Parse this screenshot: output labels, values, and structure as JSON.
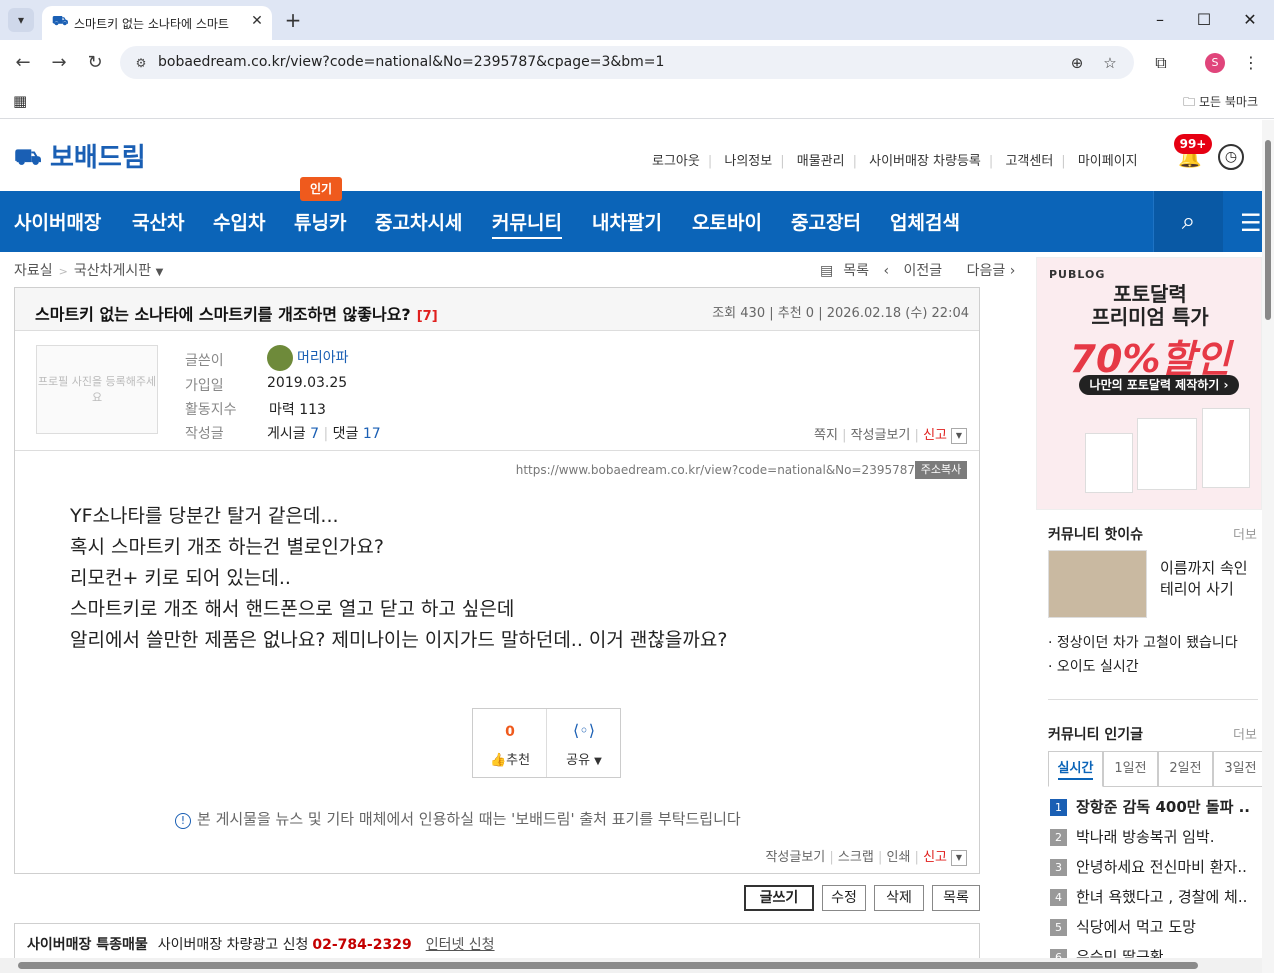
{
  "browser": {
    "tab_title": "스마트키 없는 소나타에 스마트",
    "url": "bobaedream.co.kr/view?code=national&No=2395787&cpage=3&bm=1",
    "profile_initial": "S",
    "bookmarks_all": "모든 북마크"
  },
  "header": {
    "logo_text": "보배드림",
    "links": [
      "로그아웃",
      "나의정보",
      "매물관리",
      "사이버매장 차량등록",
      "고객센터",
      "마이페이지"
    ],
    "notification_count": "99+"
  },
  "gnb": {
    "items": [
      "사이버매장",
      "국산차",
      "수입차",
      "튜닝카",
      "중고차시세",
      "커뮤니티",
      "내차팔기",
      "오토바이",
      "중고장터",
      "업체검색"
    ],
    "hot_badge": "인기"
  },
  "breadcrumb": {
    "root": "자료실",
    "board": "국산차게시판"
  },
  "post_nav": {
    "list": "목록",
    "prev": "이전글",
    "next": "다음글"
  },
  "post": {
    "title": "스마트키 없는 소나타에 스마트키를 개조하면 않좋나요?",
    "comment_count": "[7]",
    "views": "조회 430",
    "recommend": "추천 0",
    "date": "2026.02.18 (수) 22:04",
    "profile_placeholder": "프로필 사진을 등록해주세요",
    "author_label": "글쓴이",
    "author_name": "머리아파",
    "joined_label": "가입일",
    "joined": "2019.03.25",
    "activity_label": "활동지수",
    "activity": "마력 113",
    "posts_label": "작성글",
    "posts_text": "게시글",
    "posts_count": "7",
    "comments_text": "댓글",
    "comments_count": "17",
    "author_tools": [
      "쪽지",
      "작성글보기"
    ],
    "report": "신고",
    "permalink": "https://www.bobaedream.co.kr/view?code=national&No=2395787",
    "copy_label": "주소복사",
    "body": [
      "YF소나타를 당분간 탈거 같은데...",
      "혹시 스마트키 개조 하는건 별로인가요?",
      "리모컨+ 키로 되어 있는데..",
      "스마트키로 개조 해서 핸드폰으로 열고 닫고 하고 싶은데",
      "알리에서 쓸만한 제품은 없나요? 제미나이는 이지가드 말하던데..  이거 괜찮을까요?"
    ],
    "rec_count": "0",
    "rec_label": "추천",
    "share_label": "공유",
    "notice": "본 게시물을 뉴스 및 기타 매체에서 인용하실 때는 '보배드림' 출처 표기를 부탁드립니다",
    "bottom_tools": [
      "작성글보기",
      "스크랩",
      "인쇄"
    ]
  },
  "actions": {
    "write": "글쓰기",
    "edit": "수정",
    "delete": "삭제",
    "list": "목록"
  },
  "ad_bar": {
    "title": "사이버매장 특종매물",
    "text": "사이버매장 차량광고 신청",
    "phone": "02-784-2329",
    "link": "인터넷 신청"
  },
  "sidebar": {
    "ad": {
      "brand": "PUBLOG",
      "line1": "포토달력",
      "line2": "프리미엄 특가",
      "sale": "70%할인",
      "cta": "나만의 포토달력 제작하기  ›"
    },
    "hot_title": "커뮤니티 핫이슈",
    "more": "더보",
    "hot_caption": "이름까지 속인 테리어 사기",
    "hot_links": [
      "정상이던 차가 고철이 됐습니다",
      "오이도 실시간"
    ],
    "popular_title": "커뮤니티 인기글",
    "popular_tabs": [
      "실시간",
      "1일전",
      "2일전",
      "3일전"
    ],
    "popular": [
      "장항준 감독 400만 돌파 ..",
      "박나래 방송복귀 임박.",
      "안녕하세요 전신마비 환자..",
      "한녀 욕했다고 , 경찰에 체..",
      "식당에서 먹고 도망",
      "유승민 딸근황"
    ]
  }
}
